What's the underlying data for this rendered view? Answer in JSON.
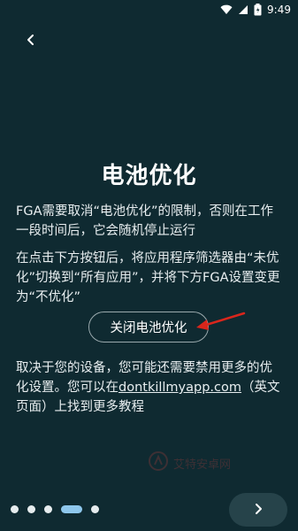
{
  "status_bar": {
    "time": "9:49"
  },
  "page": {
    "title": "电池优化",
    "paragraph1": "FGA需要取消“电池优化”的限制，否则在工作一段时间后，它会随机停止运行",
    "paragraph2": "在点击下方按钮后，将应用程序筛选器由“未优化”切换到“所有应用”，并将下方FGA设置变更为“不优化”",
    "button_label": "关闭电池优化",
    "paragraph3_before": "取决于您的设备，您可能还需要禁用更多的优化设置。您可以在",
    "paragraph3_link": "dontkillmyapp.com",
    "paragraph3_after": "（英文页面）上找到更多教程"
  },
  "watermark": {
    "text": "艾特安卓网"
  },
  "pager": {
    "count": 5,
    "active_index": 3
  },
  "icons": {
    "back": "chevron-left-icon",
    "next": "chevron-right-icon",
    "wifi": "wifi-icon",
    "signal": "signal-icon",
    "battery": "battery-icon"
  },
  "colors": {
    "background": "#0f2a31",
    "accent_dot": "#8ec7ec",
    "arrow": "#d9261c"
  }
}
